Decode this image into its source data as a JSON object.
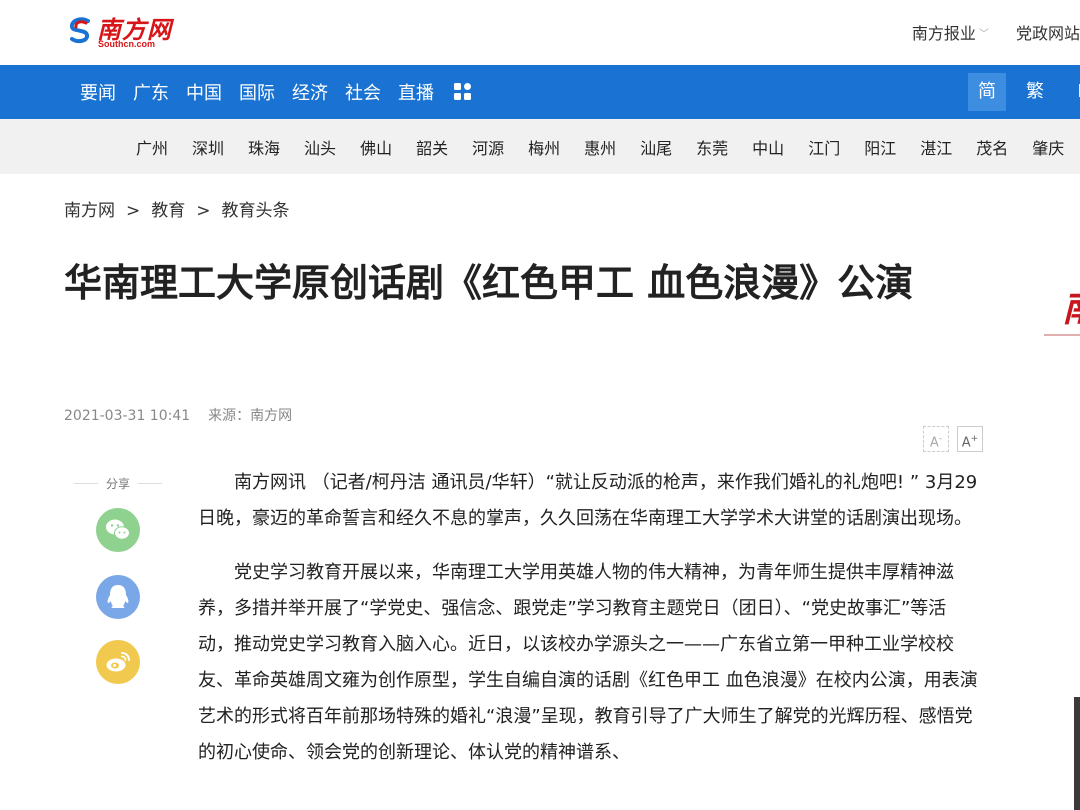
{
  "header": {
    "logo_cn": "南方网",
    "logo_en": "Southcn.com",
    "links": [
      "南方报业",
      "党政网站"
    ]
  },
  "main_nav": {
    "items": [
      "要闻",
      "广东",
      "中国",
      "国际",
      "经济",
      "社会",
      "直播"
    ],
    "grid_icon": "grid-icon",
    "lang": [
      "简",
      "繁",
      "E"
    ],
    "active_lang": "简"
  },
  "city_nav": [
    "广州",
    "深圳",
    "珠海",
    "汕头",
    "佛山",
    "韶关",
    "河源",
    "梅州",
    "惠州",
    "汕尾",
    "东莞",
    "中山",
    "江门",
    "阳江",
    "湛江",
    "茂名",
    "肇庆"
  ],
  "breadcrumb": [
    "南方网",
    "教育",
    "教育头条"
  ],
  "breadcrumb_sep": ">",
  "article": {
    "title": "华南理工大学原创话剧《红色甲工 血色浪漫》公演",
    "datetime": "2021-03-31 10:41",
    "source": "来源：南方网",
    "font_small": "A",
    "font_large": "A",
    "paragraphs": [
      "南方网讯 （记者/柯丹洁 通讯员/华轩）“就让反动派的枪声，来作我们婚礼的礼炮吧! ” 3月29日晚，豪迈的革命誓言和经久不息的掌声，久久回荡在华南理工大学学术大讲堂的话剧演出现场。",
      "党史学习教育开展以来，华南理工大学用英雄人物的伟大精神，为青年师生提供丰厚精神滋养，多措并举开展了“学党史、强信念、跟党走”学习教育主题党日（团日）、“党史故事汇”等活动，推动党史学习教育入脑入心。近日，以该校办学源头之一——广东省立第一甲种工业学校校友、革命英雄周文雍为创作原型，学生自编自演的话剧《红色甲工 血色浪漫》在校内公演，用表演艺术的形式将百年前那场特殊的婚礼“浪漫”呈现，教育引导了广大师生了解党的光辉历程、感悟党的初心使命、领会党的创新理论、体认党的精神谱系、"
    ]
  },
  "share": {
    "label": "分享",
    "buttons": [
      "wechat-icon",
      "qq-icon",
      "weibo-icon"
    ]
  },
  "right_ad_glyph": "南",
  "colors": {
    "brand_red": "#d71518",
    "nav_blue": "#1a73d2",
    "nav_active": "#3d8de0",
    "city_bg": "#f1f1f1"
  }
}
